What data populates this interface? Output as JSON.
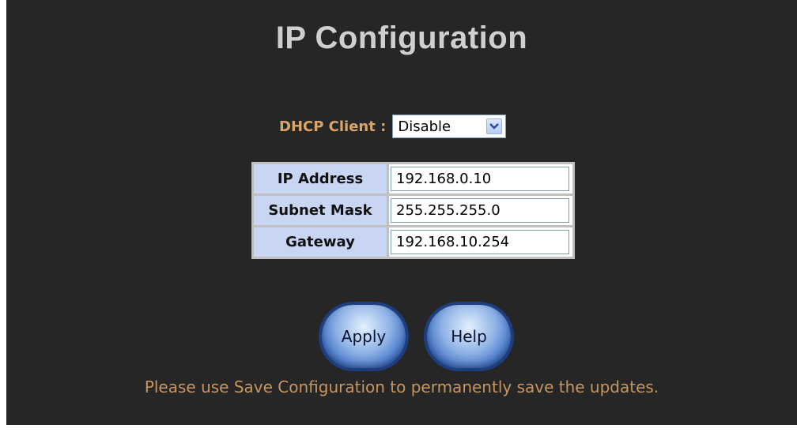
{
  "page": {
    "title": "IP Configuration",
    "background_color": "#262626",
    "accent_color": "#d9a56b"
  },
  "dhcp": {
    "label": "DHCP Client :",
    "selected": "Disable",
    "arrow_icon": "chevron-down-icon"
  },
  "ip_table": {
    "rows": [
      {
        "label": "IP Address",
        "value": "192.168.0.10"
      },
      {
        "label": "Subnet Mask",
        "value": "255.255.255.0"
      },
      {
        "label": "Gateway",
        "value": "192.168.10.254"
      }
    ]
  },
  "buttons": {
    "apply_label": "Apply",
    "help_label": "Help"
  },
  "note": "Please use Save Configuration to permanently save the updates."
}
